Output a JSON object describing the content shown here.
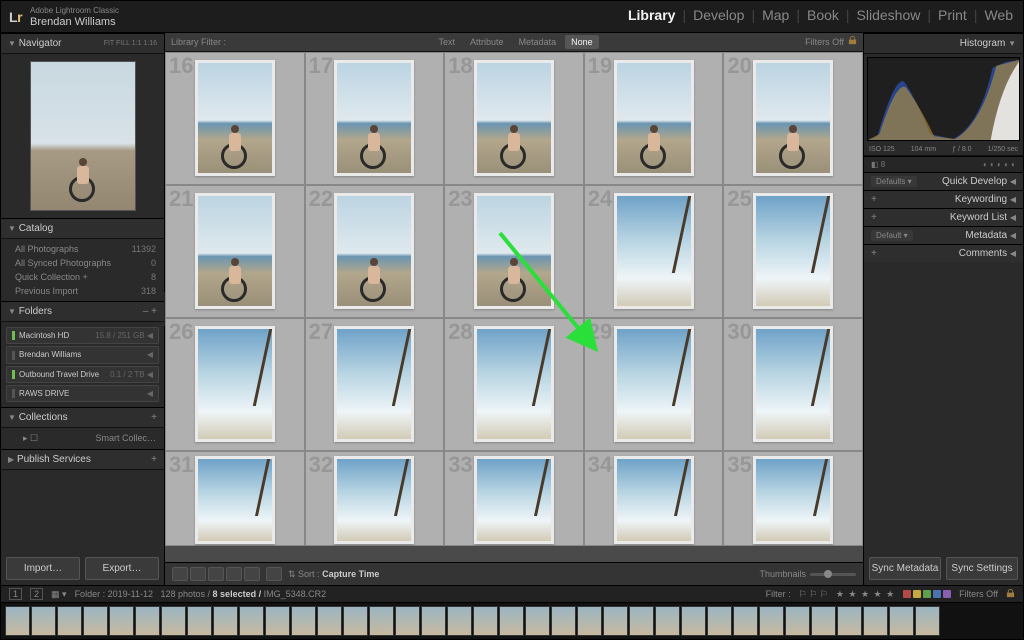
{
  "brand": {
    "product": "Adobe Lightroom Classic",
    "owner": "Brendan Williams",
    "logo_l": "L",
    "logo_r": "r"
  },
  "modules": {
    "items": [
      "Library",
      "Develop",
      "Map",
      "Book",
      "Slideshow",
      "Print",
      "Web"
    ],
    "active": "Library"
  },
  "left": {
    "navigator": {
      "title": "Navigator",
      "modes": "FIT   FILL   1:1   1:16"
    },
    "catalog": {
      "title": "Catalog",
      "items": [
        {
          "label": "All Photographs",
          "count": "11392"
        },
        {
          "label": "All Synced Photographs",
          "count": "0"
        },
        {
          "label": "Quick Collection  +",
          "count": "8"
        },
        {
          "label": "Previous Import",
          "count": "318"
        }
      ]
    },
    "folders": {
      "title": "Folders",
      "plusminus": "– +",
      "drives": [
        {
          "label": "Macintosh HD",
          "meta": "15.8 / 251 GB",
          "active": true
        },
        {
          "label": "Brendan Williams",
          "meta": "",
          "active": false,
          "dim": true
        },
        {
          "label": "Outbound Travel Drive",
          "meta": "0.1 / 2 TB",
          "active": true
        },
        {
          "label": "RAWS DRIVE",
          "meta": "",
          "active": false,
          "dim": true
        }
      ]
    },
    "collections": {
      "title": "Collections",
      "plus": "+",
      "items": [
        {
          "label": "Smart Collec…"
        }
      ]
    },
    "publish": {
      "title": "Publish Services",
      "plus": "+"
    },
    "buttons": {
      "import": "Import…",
      "export": "Export…"
    }
  },
  "filterbar": {
    "label": "Library Filter :",
    "tabs": [
      "Text",
      "Attribute",
      "Metadata",
      "None"
    ],
    "active": "None",
    "filters_off": "Filters Off"
  },
  "grid": {
    "start": 16,
    "rows": 4,
    "cols": 5,
    "row_palm_start": 3
  },
  "midbar": {
    "sort_label": "Sort :",
    "sort_value": "Capture Time",
    "thumbnails": "Thumbnails"
  },
  "right": {
    "histogram": {
      "title": "Histogram",
      "values": {
        "iso": "ISO 125",
        "focal": "104 mm",
        "aperture": "ƒ / 8.0",
        "shutter": "1/250 sec"
      }
    },
    "panels": [
      {
        "label": "Quick Develop",
        "dd": "Defaults"
      },
      {
        "label": "Keywording",
        "dd": ""
      },
      {
        "label": "Keyword List",
        "dd": ""
      },
      {
        "label": "Metadata",
        "dd": "Default"
      },
      {
        "label": "Comments",
        "dd": ""
      }
    ],
    "buttons": {
      "sync_meta": "Sync Metadata",
      "sync_settings": "Sync Settings"
    }
  },
  "status": {
    "folder_label": "Folder :",
    "folder": "2019-11-12",
    "count": "128 photos /",
    "selected": "8 selected /",
    "file": "IMG_5348.CR2",
    "filter_label": "Filter :",
    "filters_off": "Filters Off",
    "colors": [
      "#b24a4a",
      "#c7a93f",
      "#5e9e4d",
      "#4a73b2",
      "#8a5fb0"
    ]
  },
  "filmstrip": {
    "count": 36
  }
}
